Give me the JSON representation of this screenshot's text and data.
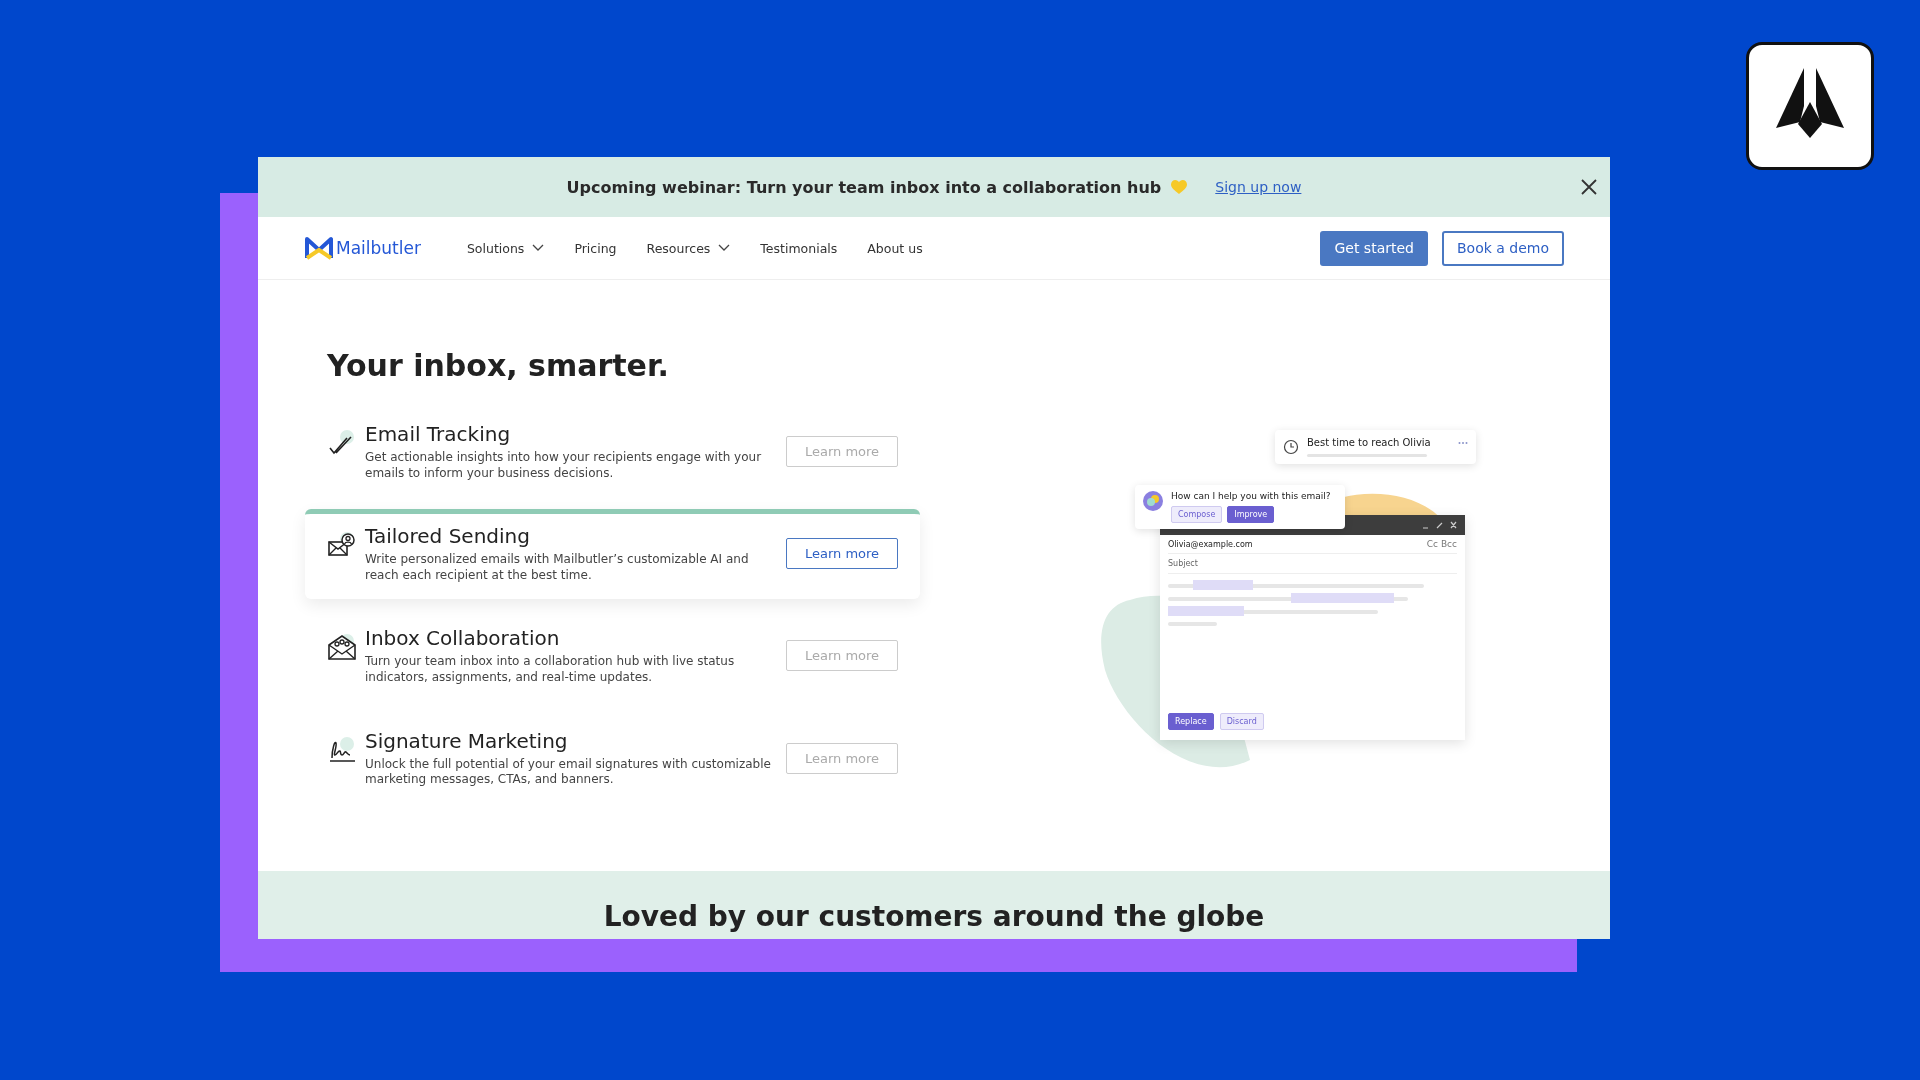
{
  "banner": {
    "text": "Upcoming webinar: Turn your team inbox into a collaboration hub",
    "link": "Sign up now"
  },
  "nav": {
    "logo": "Mailbutler",
    "items": [
      {
        "label": "Solutions",
        "dropdown": true
      },
      {
        "label": "Pricing",
        "dropdown": false
      },
      {
        "label": "Resources",
        "dropdown": true
      },
      {
        "label": "Testimonials",
        "dropdown": false
      },
      {
        "label": "About us",
        "dropdown": false
      }
    ],
    "primary_button": "Get started",
    "secondary_button": "Book a demo"
  },
  "hero": {
    "title": "Your inbox, smarter."
  },
  "features": [
    {
      "kind": "tracking",
      "title": "Email Tracking",
      "description": "Get actionable insights into how your recipients engage with your emails to inform your business decisions.",
      "button": "Learn more",
      "selected": false
    },
    {
      "kind": "sending",
      "title": "Tailored Sending",
      "description": "Write personalized emails with Mailbutler’s customizable AI and reach each recipient at the best time.",
      "button": "Learn more",
      "selected": true
    },
    {
      "kind": "collaboration",
      "title": "Inbox Collaboration",
      "description": "Turn your team inbox into a collaboration hub with live status indicators, assignments, and real-time updates.",
      "button": "Learn more",
      "selected": false
    },
    {
      "kind": "signature",
      "title": "Signature Marketing",
      "description": "Unlock the full potential of your email signatures with customizable marketing messages, CTAs, and banners.",
      "button": "Learn more",
      "selected": false
    }
  ],
  "illustration": {
    "reminder": "Best time to reach Olivia",
    "assistant_prompt": "How can I help you with this email?",
    "assistant_actions": [
      {
        "label": "Compose",
        "selected": false
      },
      {
        "label": "Improve",
        "selected": true
      }
    ],
    "recipient": "Olivia@example.com",
    "cc_bcc": "Cc Bcc",
    "subject": "Subject",
    "actions": [
      {
        "label": "Replace",
        "selected": true
      },
      {
        "label": "Discard",
        "selected": false
      }
    ]
  },
  "footer": {
    "heading": "Loved by our customers around the globe"
  }
}
